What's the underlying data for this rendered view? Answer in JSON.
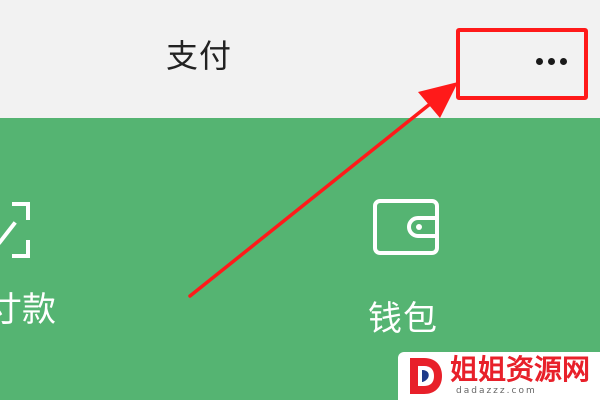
{
  "header": {
    "title": "支付",
    "more_icon": "more-horizontal-icon"
  },
  "panel": {
    "background_color": "#55b472",
    "tiles": [
      {
        "label": "付款",
        "visible_label": "寸款",
        "icon": "scan-icon"
      },
      {
        "label": "钱包",
        "icon": "wallet-icon"
      }
    ]
  },
  "annotation": {
    "color": "#ff1a1a",
    "target": "more-options-button"
  },
  "watermark": {
    "brand": "姐姐资源网",
    "url": "dadazzz.com"
  }
}
